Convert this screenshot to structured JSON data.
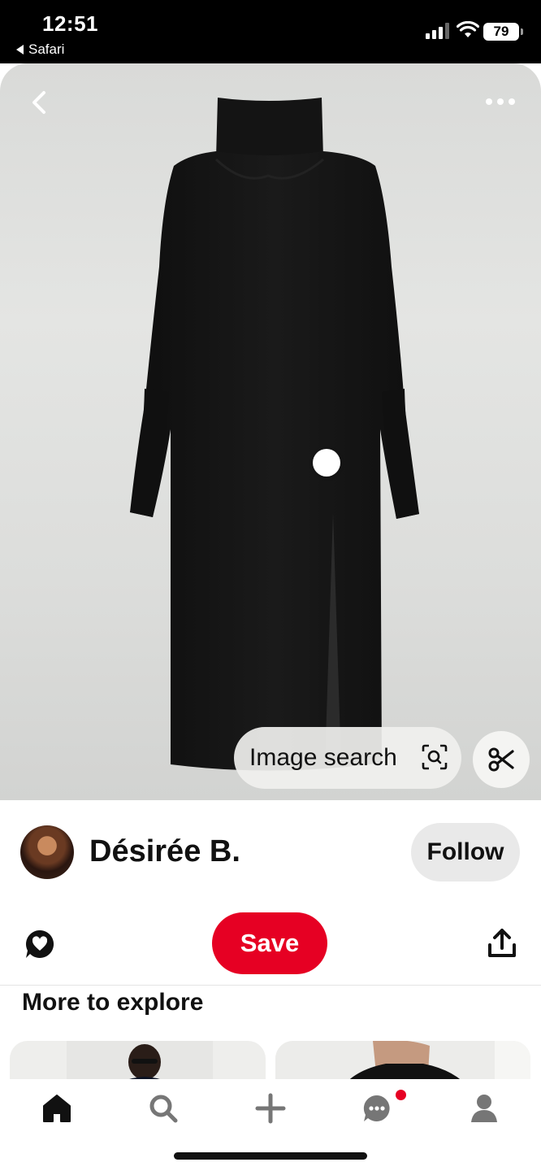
{
  "status_bar": {
    "time": "12:51",
    "back_app": "Safari",
    "battery": "79",
    "icons": [
      "signal-icon",
      "wifi-icon",
      "battery-icon"
    ]
  },
  "pin": {
    "image_alt": "black-turtleneck-sweater-dress",
    "image_search_label": "Image search",
    "icons": [
      "back-chevron-icon",
      "more-dots-icon",
      "lens-icon",
      "scissors-icon"
    ]
  },
  "creator": {
    "name": "Désirée B.",
    "follow_label": "Follow"
  },
  "actions": {
    "save_label": "Save",
    "icons": [
      "react-heart-icon",
      "share-icon"
    ]
  },
  "explore": {
    "title": "More to explore"
  },
  "bottom_nav": {
    "items": [
      "home-icon",
      "search-icon",
      "create-plus-icon",
      "messages-icon",
      "profile-icon"
    ],
    "active": "home",
    "accent": "#e60023"
  }
}
